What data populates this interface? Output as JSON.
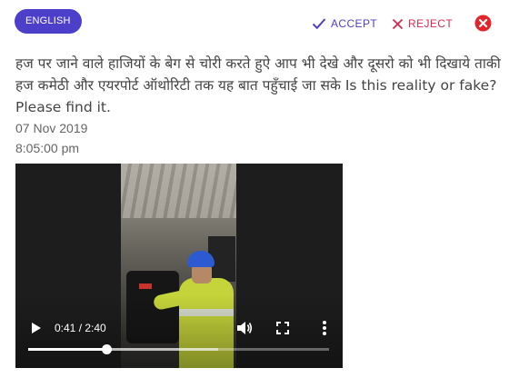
{
  "header": {
    "language_badge": "ENGLISH",
    "accept_label": "ACCEPT",
    "reject_label": "REJECT",
    "accept_color": "#4c3fc9",
    "reject_color": "#d8294e",
    "close_color": "#e3242b"
  },
  "message": {
    "text": "हज पर जाने वाले हाजियों के बेग से चोरी करते हुऐ आप भी देखे और दूसरो को भी दिखाये ताकी हज कमेठी और एयरपोर्ट ऑथोरिटी तक यह बात पहुँचाई जा सके Is this reality or fake? Please find it.",
    "date": "07 Nov 2019",
    "time": "8:05:00 pm"
  },
  "video": {
    "current_time": "0:41",
    "duration": "2:40",
    "timecode": "0:41 / 2:40",
    "played_fraction": 0.26,
    "buffered_fraction": 0.63,
    "icons": [
      "play-icon",
      "volume-icon",
      "fullscreen-icon",
      "more-vert-icon"
    ]
  }
}
